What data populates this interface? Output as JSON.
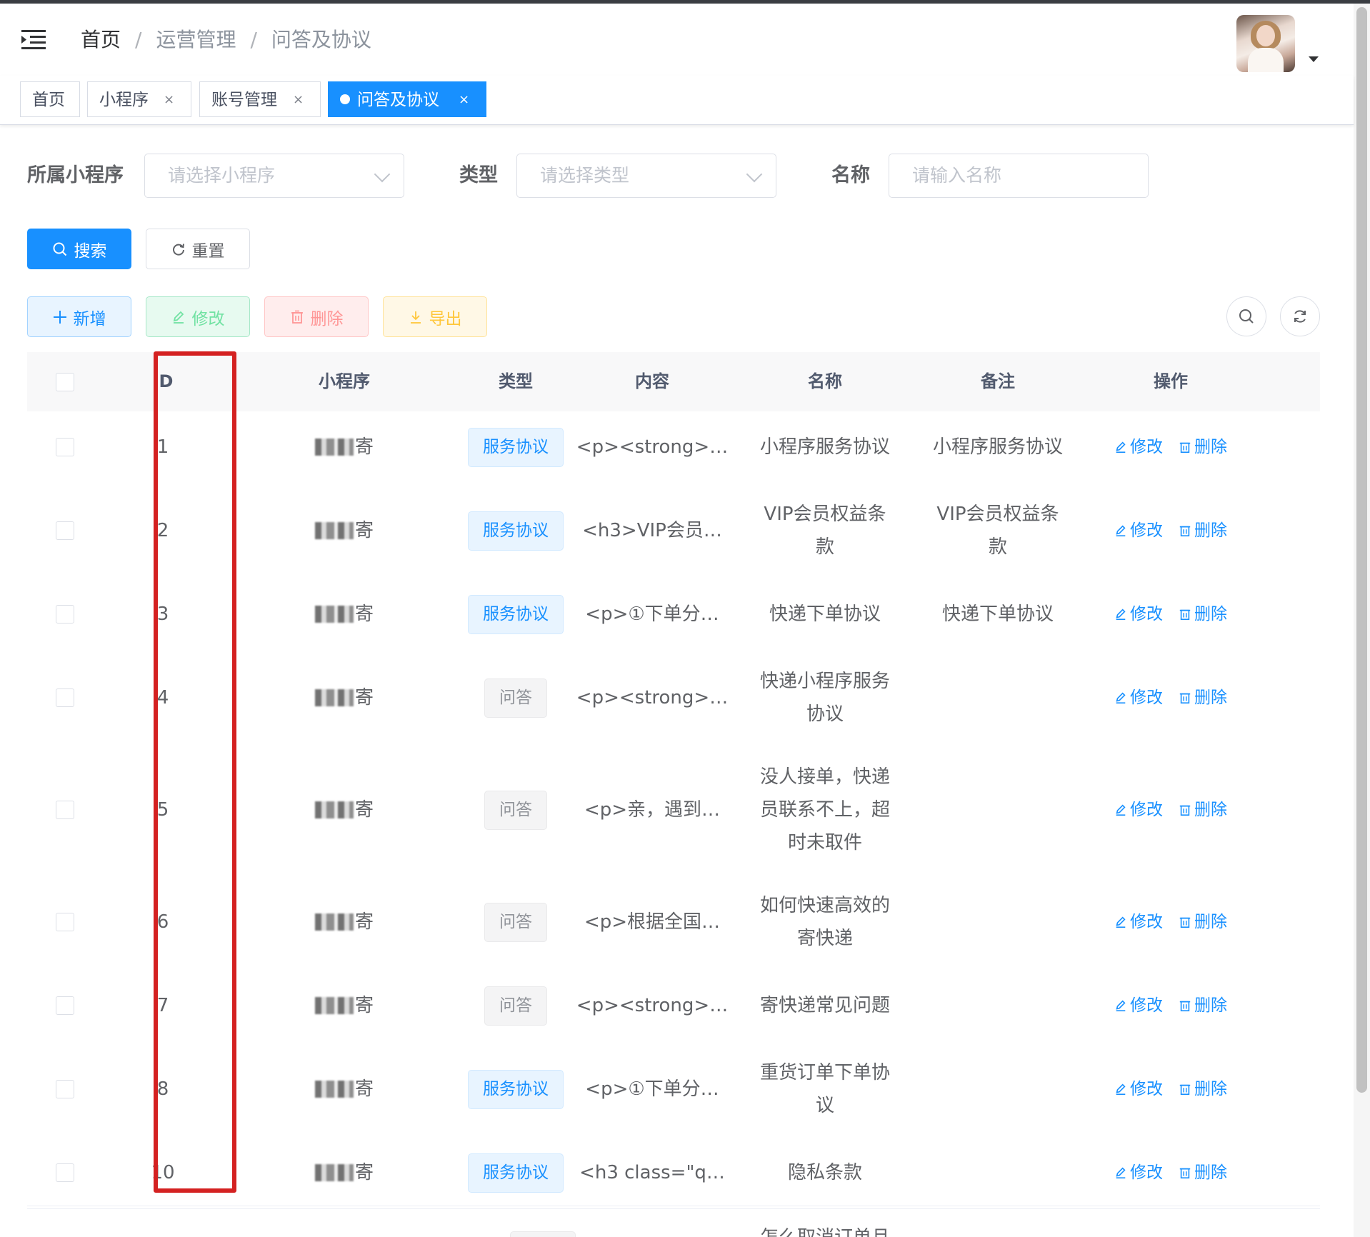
{
  "navbar": {
    "breadcrumbs": [
      "首页",
      "运营管理",
      "问答及协议"
    ],
    "separator": "/"
  },
  "tags": [
    {
      "label": "首页",
      "closable": false,
      "active": false
    },
    {
      "label": "小程序",
      "closable": true,
      "active": false
    },
    {
      "label": "账号管理",
      "closable": true,
      "active": false
    },
    {
      "label": "问答及协议",
      "closable": true,
      "active": true
    }
  ],
  "tag_close_glyph": "×",
  "search_form": {
    "app_label": "所属小程序",
    "app_placeholder": "请选择小程序",
    "type_label": "类型",
    "type_placeholder": "请选择类型",
    "name_label": "名称",
    "name_placeholder": "请输入名称",
    "search_button": "搜索",
    "reset_button": "重置"
  },
  "toolbar": {
    "add": "新增",
    "edit": "修改",
    "delete": "删除",
    "export": "导出"
  },
  "table": {
    "headers": [
      "ID",
      "小程序",
      "类型",
      "内容",
      "名称",
      "备注",
      "操作"
    ],
    "row_actions": {
      "edit": "修改",
      "delete": "删除"
    },
    "rows": [
      {
        "id": "1",
        "app": "寄",
        "type": "服务协议",
        "content": "<p><strong>…",
        "name": "小程序服务协议",
        "remark": "小程序服务协议"
      },
      {
        "id": "2",
        "app": "寄",
        "type": "服务协议",
        "content": "<h3>VIP会员…",
        "name": "VIP会员权益条款",
        "remark": "VIP会员权益条款"
      },
      {
        "id": "3",
        "app": "寄",
        "type": "服务协议",
        "content": "<p>①下单分…",
        "name": "快递下单协议",
        "remark": "快递下单协议"
      },
      {
        "id": "4",
        "app": "寄",
        "type": "问答",
        "content": "<p><strong>…",
        "name": "快递小程序服务协议",
        "remark": ""
      },
      {
        "id": "5",
        "app": "寄",
        "type": "问答",
        "content": "<p>亲，遇到…",
        "name": "没人接单，快递员联系不上，超时未取件",
        "remark": ""
      },
      {
        "id": "6",
        "app": "寄",
        "type": "问答",
        "content": "<p>根据全国…",
        "name": "如何快速高效的寄快递",
        "remark": ""
      },
      {
        "id": "7",
        "app": "寄",
        "type": "问答",
        "content": "<p><strong>…",
        "name": "寄快递常见问题",
        "remark": ""
      },
      {
        "id": "8",
        "app": "寄",
        "type": "服务协议",
        "content": "<p>①下单分…",
        "name": "重货订单下单协议",
        "remark": ""
      },
      {
        "id": "10",
        "app": "寄",
        "type": "服务协议",
        "content": "<h3 class=\"q…",
        "name": "隐私条款",
        "remark": ""
      }
    ],
    "partial_row_name": "怎么取消订单且"
  },
  "colors": {
    "primary": "#1890ff",
    "highlight_box": "#d42121"
  }
}
